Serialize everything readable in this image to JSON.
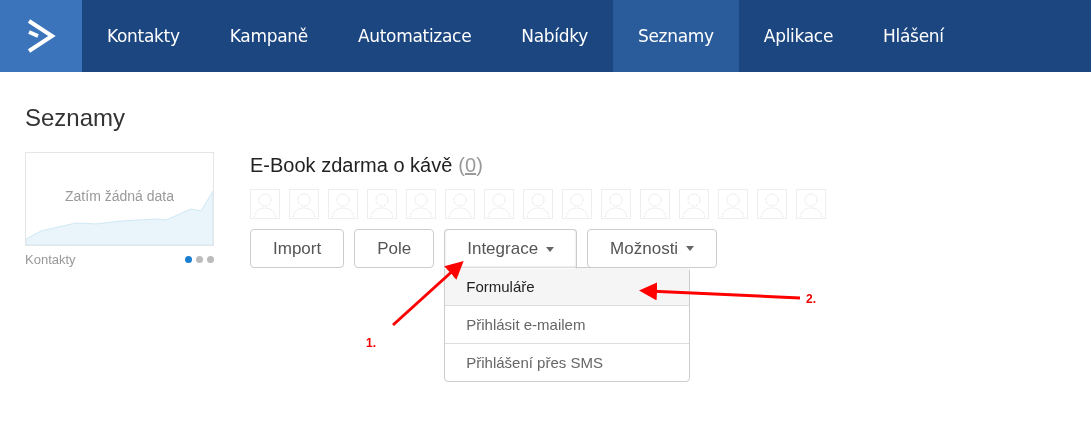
{
  "nav": {
    "items": [
      {
        "label": "Kontakty",
        "selected": false
      },
      {
        "label": "Kampaně",
        "selected": false
      },
      {
        "label": "Automatizace",
        "selected": false
      },
      {
        "label": "Nabídky",
        "selected": false
      },
      {
        "label": "Seznamy",
        "selected": true
      },
      {
        "label": "Aplikace",
        "selected": false
      },
      {
        "label": "Hlášení",
        "selected": false
      }
    ]
  },
  "page_title": "Seznamy",
  "stats_card": {
    "empty_text": "Zatím žádná data",
    "label": "Kontakty",
    "dots": [
      {
        "selected": true
      },
      {
        "selected": false
      },
      {
        "selected": false
      }
    ]
  },
  "list": {
    "name": "E-Book zdarma o kávě",
    "count_open": "(",
    "count": "0",
    "count_close": ")",
    "buttons": [
      {
        "label": "Import",
        "has_caret": false,
        "expanded": false
      },
      {
        "label": "Pole",
        "has_caret": false,
        "expanded": false
      },
      {
        "label": "Integrace",
        "has_caret": true,
        "expanded": true
      },
      {
        "label": "Možnosti",
        "has_caret": true,
        "expanded": false
      }
    ],
    "menu": [
      {
        "label": "Formuláře",
        "selected": true
      },
      {
        "label": "Přihlásit e-mailem",
        "selected": false
      },
      {
        "label": "Přihlášení přes SMS",
        "selected": false
      }
    ]
  },
  "annotations": [
    "1.",
    "2."
  ]
}
